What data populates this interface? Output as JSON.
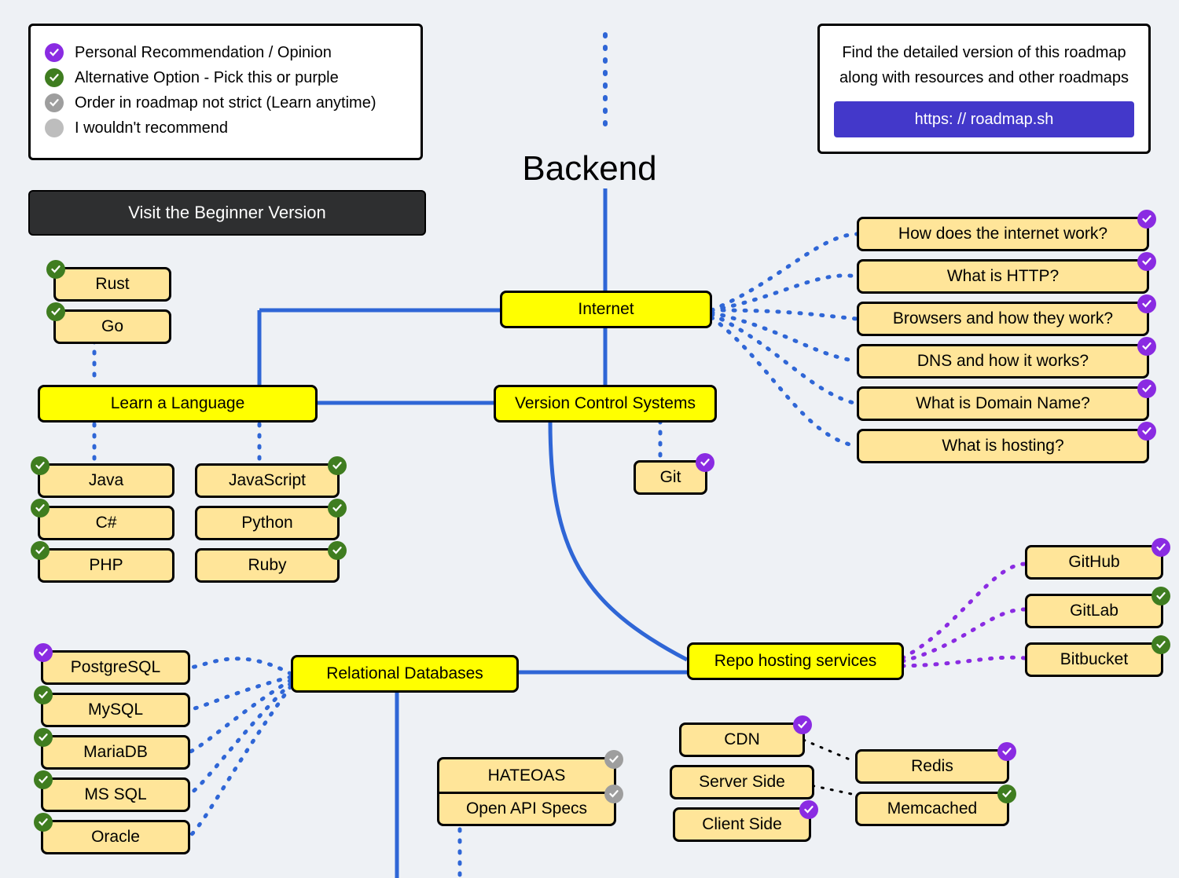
{
  "title": "Backend",
  "legend": {
    "items": [
      {
        "label": "Personal Recommendation / Opinion",
        "badge": "purple"
      },
      {
        "label": "Alternative Option - Pick this or purple",
        "badge": "green"
      },
      {
        "label": "Order in roadmap not strict (Learn anytime)",
        "badge": "grey"
      },
      {
        "label": "I wouldn't recommend",
        "badge": "plain"
      }
    ]
  },
  "beginner_button": "Visit the Beginner Version",
  "promo": {
    "text": "Find the detailed version of this roadmap along with resources and other roadmaps",
    "link_label": "https: // roadmap.sh"
  },
  "nodes": {
    "internet": "Internet",
    "vcs": "Version Control Systems",
    "learn_lang": "Learn a Language",
    "reldb": "Relational Databases",
    "repo_host": "Repo hosting services",
    "git": "Git",
    "rust": "Rust",
    "go": "Go",
    "java": "Java",
    "csharp": "C#",
    "php": "PHP",
    "javascript": "JavaScript",
    "python": "Python",
    "ruby": "Ruby",
    "how_internet": "How does the internet work?",
    "what_http": "What is HTTP?",
    "browsers": "Browsers and how they work?",
    "dns": "DNS and how it works?",
    "domain_name": "What is Domain Name?",
    "hosting": "What is hosting?",
    "github": "GitHub",
    "gitlab": "GitLab",
    "bitbucket": "Bitbucket",
    "postgres": "PostgreSQL",
    "mysql": "MySQL",
    "mariadb": "MariaDB",
    "mssql": "MS SQL",
    "oracle": "Oracle",
    "hateoas": "HATEOAS",
    "openapi": "Open API Specs",
    "cdn": "CDN",
    "server_side": "Server Side",
    "client_side": "Client Side",
    "redis": "Redis",
    "memcached": "Memcached"
  },
  "colors": {
    "purple": "#8a2be2",
    "green": "#3f7d20",
    "grey": "#9e9e9e",
    "yellow": "#ffff00",
    "tan": "#ffe599",
    "link": "#4338ca"
  }
}
